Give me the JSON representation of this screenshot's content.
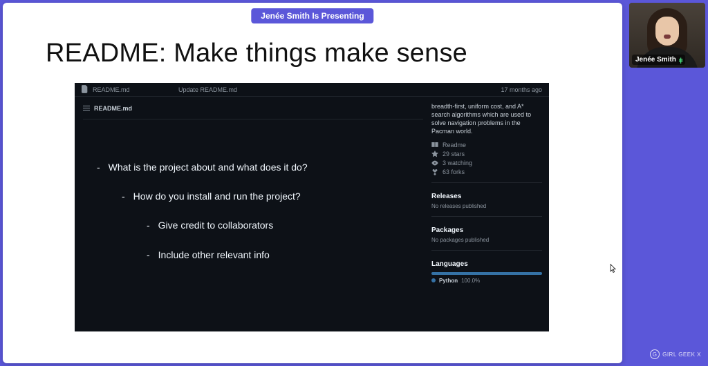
{
  "presenter_badge": "Jenée Smith Is Presenting",
  "slide": {
    "title": "README: Make things make sense",
    "bullets": [
      {
        "indent": 1,
        "text": "What is the project about and what does it do?"
      },
      {
        "indent": 2,
        "text": "How do you install and run the project?"
      },
      {
        "indent": 3,
        "text": "Give credit to collaborators"
      },
      {
        "indent": 3,
        "text": "Include other relevant info"
      }
    ]
  },
  "github": {
    "file_row": {
      "name": "README.md",
      "commit_msg": "Update README.md",
      "when": "17 months ago"
    },
    "readme_header": "README.md",
    "about_desc": "breadth-first, uniform cost, and A* search algorithms which are used to solve navigation problems in the Pacman world.",
    "meta": {
      "readme": "Readme",
      "stars": "29 stars",
      "watching": "3 watching",
      "forks": "63 forks"
    },
    "releases": {
      "heading": "Releases",
      "sub": "No releases published"
    },
    "packages": {
      "heading": "Packages",
      "sub": "No packages published"
    },
    "languages": {
      "heading": "Languages",
      "name": "Python",
      "pct": "100.0%"
    }
  },
  "webcam": {
    "name": "Jenée Smith"
  },
  "brand": {
    "text": "GIRL GEEK X"
  }
}
